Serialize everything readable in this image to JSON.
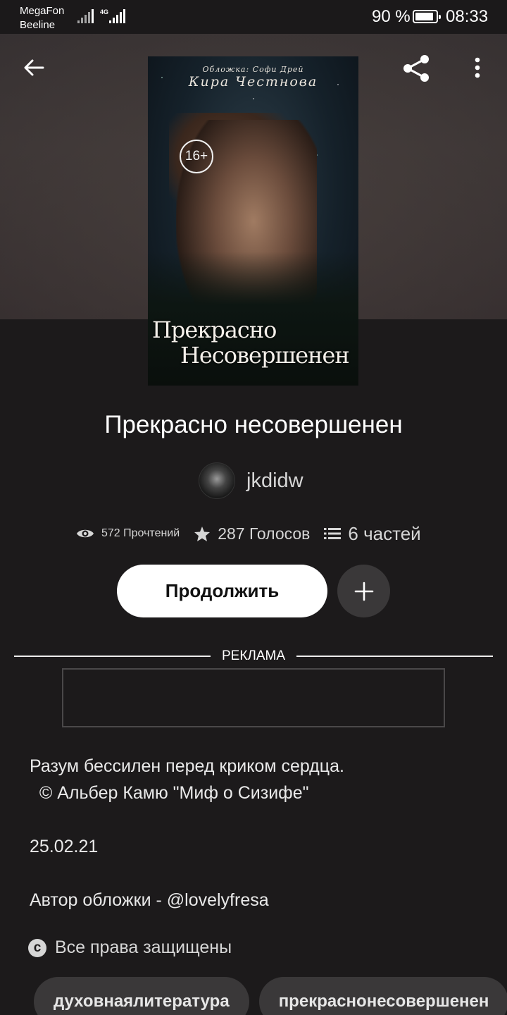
{
  "status_bar": {
    "carrier_1": "MegaFon",
    "carrier_2": "Beeline",
    "network": "4G",
    "battery": "90 %",
    "battery_level": 0.9,
    "time": "08:33"
  },
  "toolbar": {
    "back_icon": "arrow-left-icon",
    "share_icon": "share-icon",
    "more_icon": "more-vertical-icon"
  },
  "cover": {
    "top_small": "Обложка: Софи Дрей",
    "top_author": "Кира Честнова",
    "age": "16+",
    "title_line_1": "Прекрасно",
    "title_line_2": "Несовершенен"
  },
  "book": {
    "title": "Прекрасно несовершенен",
    "author": "jkdidw"
  },
  "stats": {
    "reads": "572 Прочтений",
    "votes": "287 Голосов",
    "parts": "6 частей"
  },
  "actions": {
    "continue_label": "Продолжить",
    "add_icon": "plus-icon"
  },
  "ad": {
    "label": "РЕКЛАМА"
  },
  "description": {
    "line_1": "Разум бессилен перед криком сердца.",
    "line_2": "  © Альбер Камю \"Миф о Сизифе\"",
    "date": "25.02.21",
    "cover_credit": "Автор обложки - @lovelyfresa"
  },
  "rights": {
    "label": "Все права защищены"
  },
  "tags": [
    "духовнаялитература",
    "прекраснонесовершенен"
  ]
}
